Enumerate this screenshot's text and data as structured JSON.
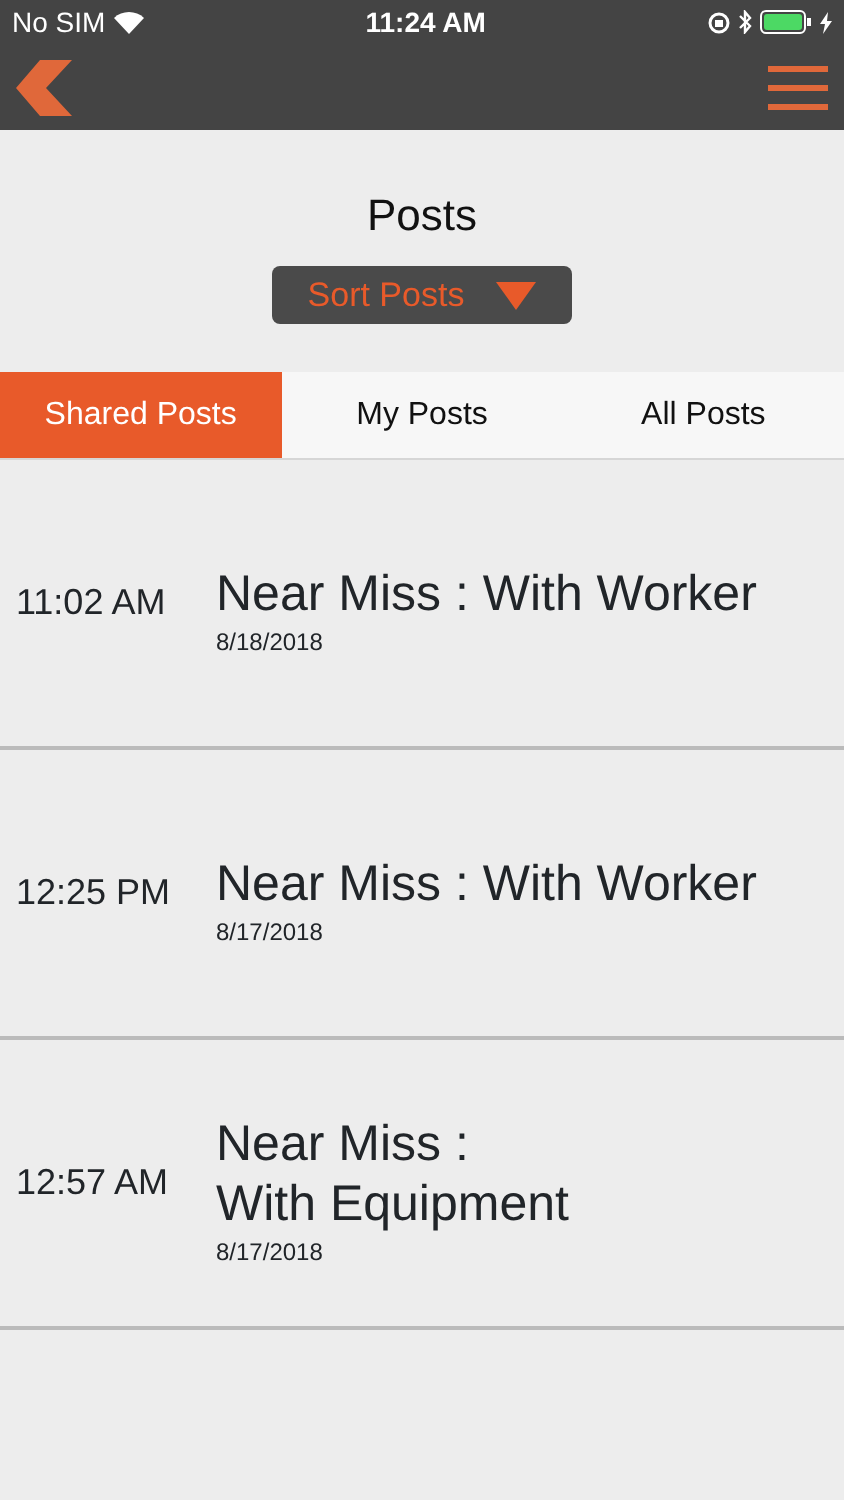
{
  "status_bar": {
    "carrier": "No SIM",
    "time": "11:24 AM"
  },
  "title": "Posts",
  "sort_button": {
    "label": "Sort Posts"
  },
  "tabs": [
    {
      "label": "Shared Posts",
      "selected": true
    },
    {
      "label": "My Posts",
      "selected": false
    },
    {
      "label": "All Posts",
      "selected": false
    }
  ],
  "posts": [
    {
      "time": "11:02 AM",
      "title": "Near Miss : With Worker",
      "date": "8/18/2018"
    },
    {
      "time": "12:25 PM",
      "title": "Near Miss : With Worker",
      "date": "8/17/2018"
    },
    {
      "time": "12:57 AM",
      "title": "Near Miss :\nWith Equipment",
      "date": "8/17/2018"
    }
  ]
}
